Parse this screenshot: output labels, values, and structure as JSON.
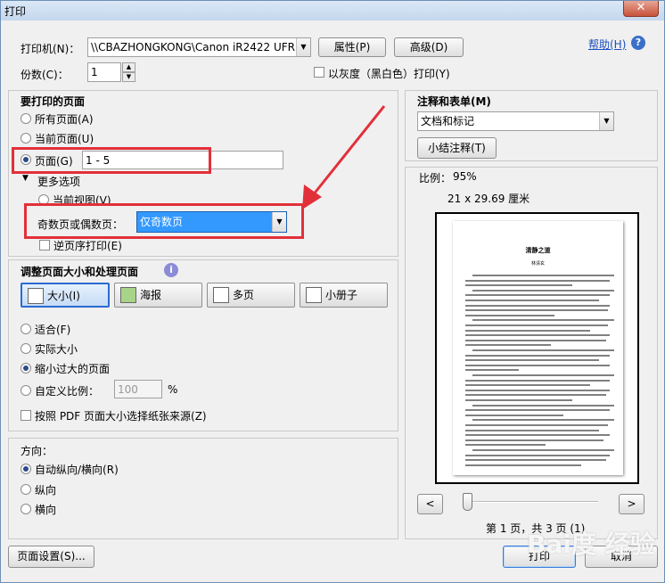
{
  "window": {
    "title": "打印",
    "close_label": "✕"
  },
  "printer": {
    "label": "打印机(N)：",
    "selected": "\\\\CBAZHONGKONG\\Canon iR2422 UFRII LT",
    "properties_label": "属性(P)",
    "advanced_label": "高级(D)",
    "help_label": "帮助(H)",
    "copies_label": "份数(C)：",
    "copies_value": "1",
    "grayscale_label": "以灰度（黑白色）打印(Y)"
  },
  "pages": {
    "heading": "要打印的页面",
    "all_label": "所有页面(A)",
    "current_label": "当前页面(U)",
    "page_label": "页面(G)",
    "page_range": "1 - 5",
    "more_label": "更多选项",
    "current_view_label": "当前视图(V)",
    "odd_even_label": "奇数页或偶数页：",
    "odd_even_value": "仅奇数页",
    "reverse_label": "逆页序打印(E)"
  },
  "sizing": {
    "heading": "调整页面大小和处理页面",
    "buttons": [
      "大小(I)",
      "海报",
      "多页",
      "小册子"
    ],
    "fit_label": "适合(F)",
    "actual_label": "实际大小",
    "shrink_label": "缩小过大的页面",
    "custom_label": "自定义比例：",
    "custom_value": "100",
    "percent": "%",
    "source_label": "按照 PDF 页面大小选择纸张来源(Z)"
  },
  "orientation": {
    "heading": "方向：",
    "auto_label": "自动纵向/横向(R)",
    "portrait_label": "纵向",
    "landscape_label": "横向"
  },
  "comments": {
    "heading": "注释和表单(M)",
    "selected": "文档和标记",
    "summarize_label": "小结注释(T)"
  },
  "preview": {
    "scale_label": "比例：",
    "scale_value": "95%",
    "size_text": "21 x 29.69 厘米",
    "doc_title": "清静之道",
    "doc_author": "林清玄",
    "prev_label": "<",
    "next_label": ">",
    "page_info": "第 1 页，共 3 页 (1)"
  },
  "footer": {
    "setup_label": "页面设置(S)...",
    "print_label": "打印",
    "cancel_label": "取消"
  },
  "watermark": "Bai度 经验",
  "colors": {
    "annotation_red": "#e2303a",
    "selected_combo": "#3399ff"
  }
}
